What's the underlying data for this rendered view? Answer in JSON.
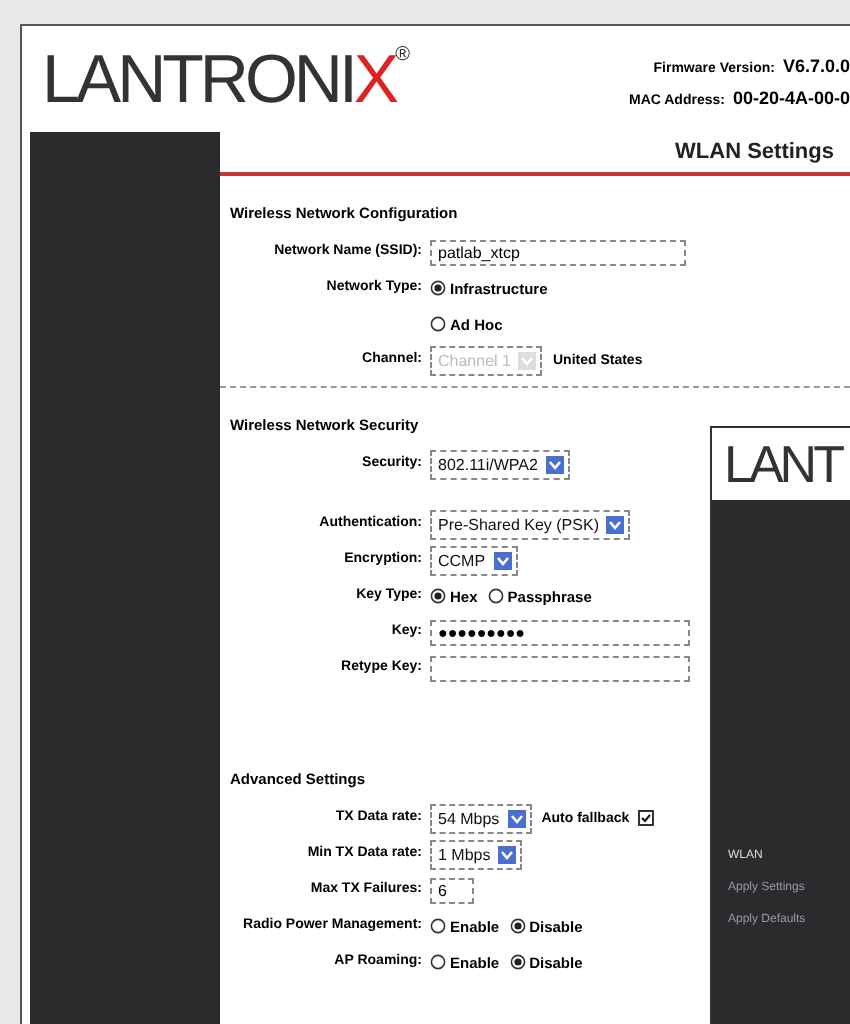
{
  "main_window": {
    "logo": {
      "text": "LANTRONI",
      "accent": "X",
      "mark": "®"
    },
    "firmware": {
      "label": "Firmware Version:",
      "value": "V6.7.0.0"
    },
    "mac": {
      "label": "MAC Address:",
      "value": "00-20-4A-00-0"
    },
    "page_title": "WLAN Settings",
    "sections": [
      {
        "title": "Wireless Network Configuration",
        "separator": true,
        "rows": [
          {
            "kind": "text",
            "label": "Network Name (SSID):",
            "value": "patlab_xtcp"
          },
          {
            "kind": "radio",
            "label": "Network Type:",
            "options": [
              {
                "label": "Infrastructure",
                "selected": true
              }
            ]
          },
          {
            "kind": "radio",
            "label": "",
            "options": [
              {
                "label": "Ad Hoc",
                "selected": false
              }
            ]
          },
          {
            "kind": "select",
            "label": "Channel:",
            "value": "Channel 1",
            "disabled": true,
            "suffix": "United States"
          }
        ]
      },
      {
        "title": "Wireless Network Security",
        "rows": [
          {
            "kind": "select",
            "label": "Security:",
            "value": "802.11i/WPA2",
            "disabled": false
          },
          {
            "kind": "spacer"
          },
          {
            "kind": "select",
            "label": "Authentication:",
            "value": "Pre-Shared Key (PSK)",
            "disabled": false
          },
          {
            "kind": "select",
            "label": "Encryption:",
            "value": "CCMP",
            "disabled": false
          },
          {
            "kind": "radio",
            "label": "Key Type:",
            "options": [
              {
                "label": "Hex",
                "selected": true
              },
              {
                "label": "Passphrase",
                "selected": false
              }
            ]
          },
          {
            "kind": "password",
            "label": "Key:",
            "value": "●●●●●●●●●"
          },
          {
            "kind": "password",
            "label": "Retype Key:",
            "value": ""
          },
          {
            "kind": "spacer"
          },
          {
            "kind": "spacer"
          }
        ]
      },
      {
        "title": "Advanced Settings",
        "rows": [
          {
            "kind": "select",
            "label": "TX Data rate:",
            "value": "54 Mbps",
            "disabled": false,
            "check": {
              "label": "Auto fallback",
              "checked": true
            }
          },
          {
            "kind": "select",
            "label": "Min TX Data rate:",
            "value": "1 Mbps",
            "disabled": false
          },
          {
            "kind": "number",
            "label": "Max TX Failures:",
            "value": "6"
          },
          {
            "kind": "radio",
            "label": "Radio Power Management:",
            "options": [
              {
                "label": "Enable",
                "selected": false
              },
              {
                "label": "Disable",
                "selected": true
              }
            ]
          },
          {
            "kind": "radio",
            "label": "AP Roaming:",
            "options": [
              {
                "label": "Enable",
                "selected": false
              },
              {
                "label": "Disable",
                "selected": true
              }
            ]
          }
        ]
      }
    ]
  },
  "second_window": {
    "logo": "LANT",
    "nav": [
      {
        "label": "WLAN",
        "kind": "plain"
      },
      {
        "label": "Apply Settings",
        "kind": "link"
      },
      {
        "label": "Apply Defaults",
        "kind": "link"
      }
    ]
  }
}
